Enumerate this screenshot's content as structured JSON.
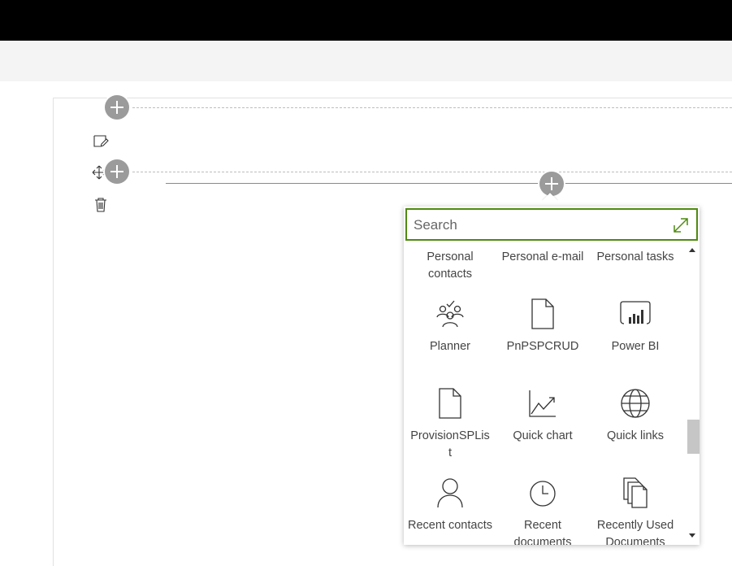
{
  "search": {
    "placeholder": "Search"
  },
  "toolbox": {
    "items": [
      {
        "label": "Personal contacts",
        "icon": "contacts-icon"
      },
      {
        "label": "Personal e-mail",
        "icon": "mail-icon"
      },
      {
        "label": "Personal tasks",
        "icon": "tasks-icon"
      },
      {
        "label": "Planner",
        "icon": "planner-icon"
      },
      {
        "label": "PnPSPCRUD",
        "icon": "document-icon"
      },
      {
        "label": "Power BI",
        "icon": "power-bi-icon"
      },
      {
        "label": "ProvisionSPList",
        "icon": "document-icon"
      },
      {
        "label": "Quick chart",
        "icon": "chart-icon"
      },
      {
        "label": "Quick links",
        "icon": "globe-icon"
      },
      {
        "label": "Recent contacts",
        "icon": "person-icon"
      },
      {
        "label": "Recent documents",
        "icon": "clock-icon"
      },
      {
        "label": "Recently Used Documents",
        "icon": "documents-icon"
      }
    ]
  },
  "colors": {
    "accent": "#4f8a10",
    "plus_button": "#9b9b9b",
    "top_bar": "#000000"
  }
}
